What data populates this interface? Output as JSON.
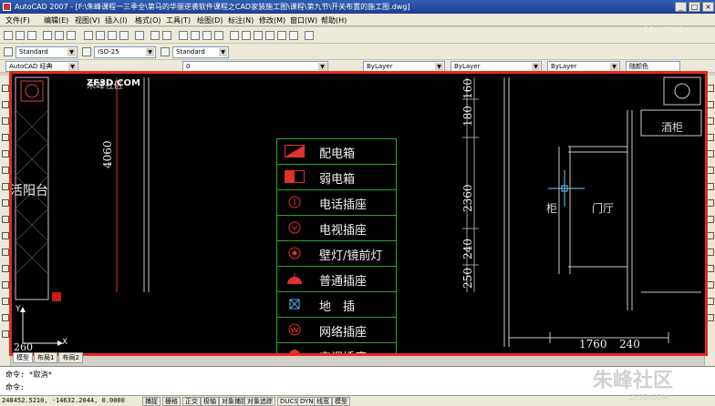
{
  "window": {
    "title": "AutoCAD 2007 - [F:\\朱峰课程一三季全\\第马的华丽逆袭软件课程之CAD家装施工图\\课程\\第九节\\开关布置的施工图.dwg]",
    "buttons": [
      "_",
      "□",
      "×"
    ]
  },
  "menu": [
    "文件(F)",
    "编辑(E)",
    "视图(V)",
    "插入(I)",
    "格式(O)",
    "工具(T)",
    "绘图(D)",
    "标注(N)",
    "修改(M)",
    "窗口(W)",
    "帮助(H)"
  ],
  "styles": {
    "text_style": "Standard",
    "dim_style": "ISO-25",
    "table_style": "Standard"
  },
  "workspace": "AutoCAD 经典",
  "layer": "0",
  "properties": {
    "color": "ByLayer",
    "linetype": "ByLayer",
    "lineweight": "ByLayer",
    "plotstyle": "随颜色"
  },
  "watermark": "优酷",
  "drawing": {
    "site_logo": "ZF3D.COM",
    "site_caption": "朱峰社区",
    "room_balcony": "活阳台",
    "room_hall": "门厅",
    "room_kitchen_partial": "柜",
    "cabinet_label": "酒柜",
    "dim_left": "4060",
    "dims_right": [
      "160",
      "180",
      "2360",
      "240",
      "250"
    ],
    "dims_bottom": [
      "1760",
      "240"
    ],
    "ucs_x": "X",
    "ucs_y": "Y",
    "corner_dim": "260"
  },
  "legend": [
    {
      "label": "配电箱",
      "icon": "distribution-box-icon"
    },
    {
      "label": "弱电箱",
      "icon": "weak-current-box-icon"
    },
    {
      "label": "电话插座",
      "icon": "phone-socket-icon"
    },
    {
      "label": "电视插座",
      "icon": "tv-socket-icon"
    },
    {
      "label": "壁灯/镜前灯",
      "icon": "wall-lamp-icon"
    },
    {
      "label": "普通插座",
      "icon": "normal-socket-icon"
    },
    {
      "label": "地　插",
      "icon": "floor-socket-icon"
    },
    {
      "label": "网络插座",
      "icon": "network-socket-icon"
    },
    {
      "label": "空调插座",
      "icon": "ac-socket-icon"
    }
  ],
  "layout_tabs": [
    "模型",
    "布局1",
    "布局2"
  ],
  "command": {
    "line1": "命令: *取消*",
    "line2": "命令:"
  },
  "status": {
    "coords": "248452.5210, -14632.2044, 0.0000",
    "toggles": [
      "捕捉",
      "栅格",
      "正交",
      "极轴",
      "对象捕捉",
      "对象追踪",
      "DUCS",
      "DYN",
      "线宽",
      "模型"
    ]
  },
  "footer_logo": "朱峰社区",
  "footer_url": "ZF3D.COM"
}
